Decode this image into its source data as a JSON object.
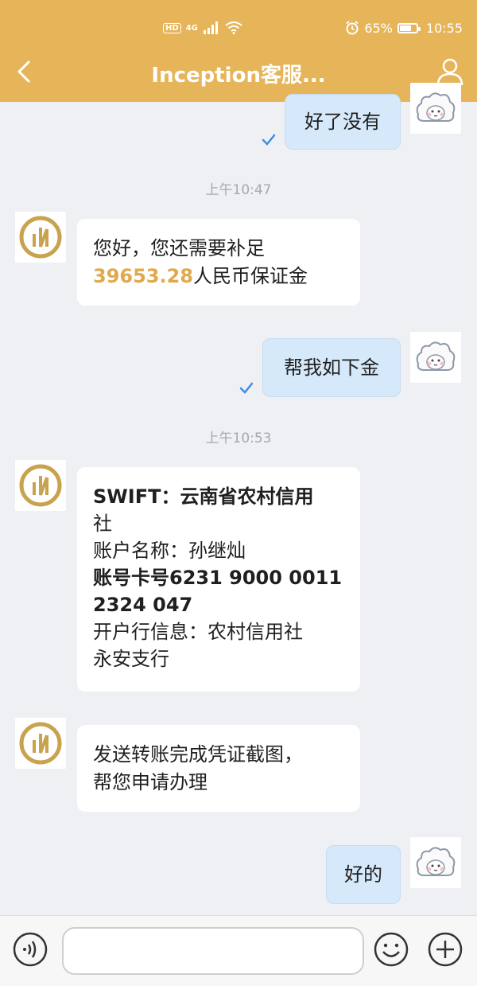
{
  "status_bar": {
    "hd": "HD",
    "network": "4G",
    "battery_percent": "65%",
    "battery_level": 0.65,
    "time": "10:55"
  },
  "header": {
    "title": "Inception客服...",
    "icons": {
      "back": "chevron-left-icon",
      "profile": "person-icon"
    }
  },
  "chat": {
    "messages": [
      {
        "type": "outgoing",
        "text": "好了没有",
        "read": true
      },
      {
        "type": "timestamp",
        "text": "上午10:47"
      },
      {
        "type": "incoming",
        "amount": "39653.28",
        "text_before_amount": "您好，您还需要补足",
        "text_after_amount": "人民币保证金"
      },
      {
        "type": "outgoing",
        "text": "帮我如下金",
        "read": true
      },
      {
        "type": "timestamp",
        "text": "上午10:53"
      },
      {
        "type": "incoming",
        "lines": [
          "SWIFT：云南省农村信用",
          "社",
          "账户名称：孙继灿",
          "账号卡号6231 9000 0011",
          "2324 047",
          "开户行信息：农村信用社",
          "永安支行"
        ]
      },
      {
        "type": "incoming",
        "lines": [
          "发送转账完成凭证截图，",
          "帮您申请办理"
        ]
      },
      {
        "type": "outgoing",
        "text": "好的",
        "read": false
      }
    ]
  },
  "input_bar": {
    "placeholder": "",
    "icons": {
      "voice": "voice-icon",
      "emoji": "emoji-icon",
      "more": "plus-icon"
    }
  },
  "colors": {
    "header_bg": "#e6b55a",
    "chat_bg": "#eef0f4",
    "outgoing_bubble": "#d6e9fa",
    "amount": "#e0a94c",
    "check": "#3d8fe0"
  }
}
